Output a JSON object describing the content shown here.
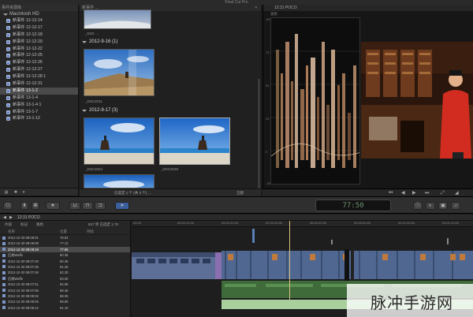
{
  "window": {
    "title": "Final Cut Pro"
  },
  "library": {
    "header": "事件资源库",
    "drive": "Macintosh HD",
    "events": [
      {
        "label": "新事件 12-12-14",
        "selected": false
      },
      {
        "label": "新事件 12-12-17",
        "selected": false
      },
      {
        "label": "新事件 12-12-18",
        "selected": false
      },
      {
        "label": "新事件 12-12-20",
        "selected": false
      },
      {
        "label": "新事件 12-12-22",
        "selected": false
      },
      {
        "label": "新事件 12-12-25",
        "selected": false
      },
      {
        "label": "新事件 12-12-26",
        "selected": false
      },
      {
        "label": "新事件 12-12-27",
        "selected": false
      },
      {
        "label": "新事件 12-12-28 1",
        "selected": false
      },
      {
        "label": "新事件 12-12-31",
        "selected": false
      },
      {
        "label": "新事件 13-1-2",
        "selected": true
      },
      {
        "label": "新事件 13-1-4",
        "selected": false
      },
      {
        "label": "新事件 13-1-4 1",
        "selected": false
      },
      {
        "label": "新事件 13-1-7",
        "selected": false
      },
      {
        "label": "新事件 13-1-12",
        "selected": false
      }
    ]
  },
  "browser": {
    "header": "新事件 …",
    "top_clip": "_DSC …",
    "groups": [
      {
        "label": "2012-9-16  (1)",
        "clips": [
          "_DSC2011"
        ]
      },
      {
        "label": "2012-9-17  (3)",
        "clips": [
          "_DSC2024",
          "_DSC2025"
        ]
      }
    ],
    "footer_status": "已选定 1 个 (共 3 个) …",
    "footer_all": "全部"
  },
  "viewer": {
    "title": "12:31  POCO",
    "scope_label": "波形",
    "ticks": [
      "100",
      "75",
      "50",
      "25",
      "0",
      "-25"
    ]
  },
  "toolbar": {
    "timecode": "77:50"
  },
  "timeline": {
    "project": "12:31  POCO",
    "tabs": [
      "片段",
      "标记",
      "角色"
    ],
    "summary": "847 项   已选定 1.70",
    "columns": [
      "名称",
      "位置",
      "持续"
    ],
    "ruler": [
      "00:00",
      "00:00:10:00",
      "00:00:20:00",
      "00:00:30:00",
      "00:00:40:00",
      "00:00:50:00",
      "00:01:00:00",
      "00:01:10:00"
    ],
    "rows": [
      {
        "name": "2012-12-30 08:08:01",
        "value": "76.62",
        "selected": false
      },
      {
        "name": "2012-12-30 08:08:08",
        "value": "77.12",
        "selected": false
      },
      {
        "name": "2012-12-30 08:08:19",
        "value": "77.65",
        "selected": true
      },
      {
        "name": "后期Waffe",
        "value": "80.35",
        "selected": false
      },
      {
        "name": "2012-12-30 08:07:29",
        "value": "80.35",
        "selected": false
      },
      {
        "name": "2012-12-30 08:07:35",
        "value": "81.25",
        "selected": false
      },
      {
        "name": "2012-12-30 08:07:48",
        "value": "82.30",
        "selected": false
      },
      {
        "name": "后期Waffe",
        "value": "83.00",
        "selected": false
      },
      {
        "name": "2012-12-30 08:07:51",
        "value": "84.95",
        "selected": false
      },
      {
        "name": "2012-12-30 08:07:58",
        "value": "86.45",
        "selected": false
      },
      {
        "name": "2012-12-30 08:08:02",
        "value": "88.05",
        "selected": false
      },
      {
        "name": "2012-12-30 08:08:05",
        "value": "89.80",
        "selected": false
      },
      {
        "name": "2012-12-30 08:08:12",
        "value": "91.10",
        "selected": false
      }
    ]
  },
  "watermark": {
    "text": "脉冲手游网"
  }
}
